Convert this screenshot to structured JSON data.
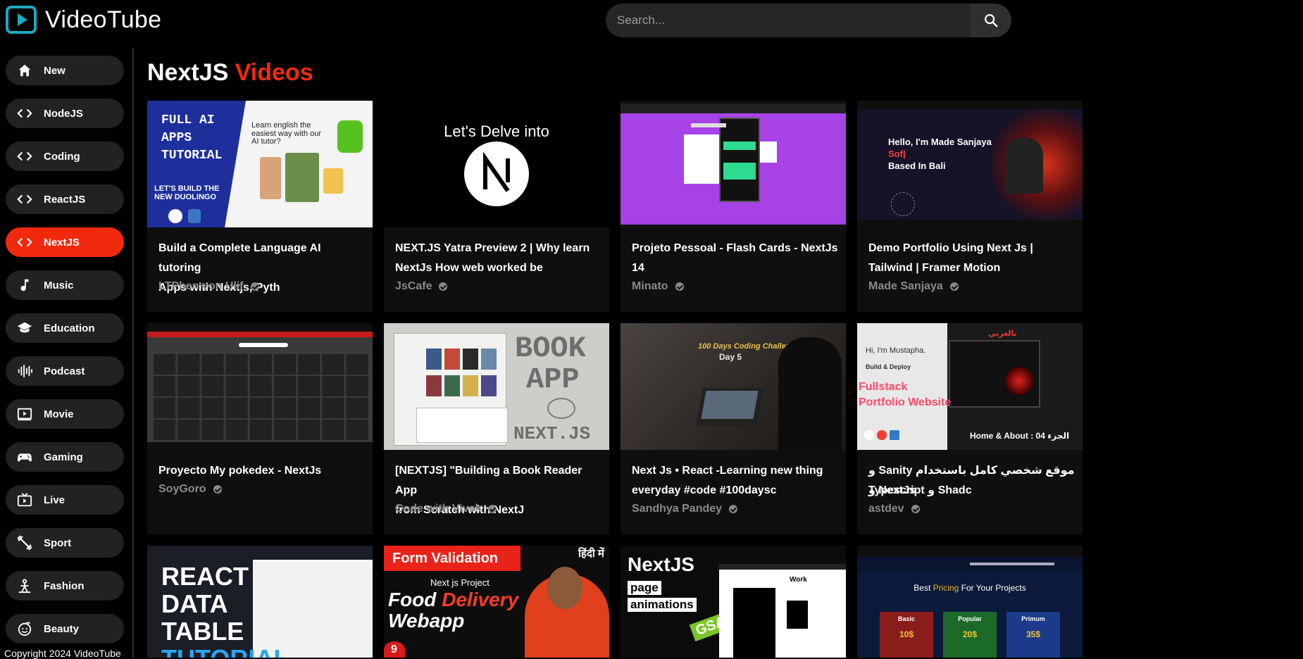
{
  "app": {
    "name": "VideoTube"
  },
  "search": {
    "placeholder": "Search..."
  },
  "sidebar": {
    "items": [
      {
        "label": "New",
        "icon": "home-icon"
      },
      {
        "label": "NodeJS",
        "icon": "code-icon"
      },
      {
        "label": "Coding",
        "icon": "code-icon"
      },
      {
        "label": "ReactJS",
        "icon": "code-icon"
      },
      {
        "label": "NextJS",
        "icon": "code-icon",
        "active": true
      },
      {
        "label": "Music",
        "icon": "music-note-icon"
      },
      {
        "label": "Education",
        "icon": "graduation-cap-icon"
      },
      {
        "label": "Podcast",
        "icon": "podcast-icon"
      },
      {
        "label": "Movie",
        "icon": "movie-icon"
      },
      {
        "label": "Gaming",
        "icon": "gamepad-icon"
      },
      {
        "label": "Live",
        "icon": "live-tv-icon"
      },
      {
        "label": "Sport",
        "icon": "sport-icon"
      },
      {
        "label": "Fashion",
        "icon": "fashion-icon"
      },
      {
        "label": "Beauty",
        "icon": "beauty-icon"
      }
    ],
    "copyright": "Copyright 2024 VideoTube"
  },
  "main": {
    "title_primary": "NextJS",
    "title_accent": "Videos",
    "videos": [
      {
        "title_line1": "Build a Complete Language AI tutoring",
        "title_line2": "Apps with Nextjs, Pyth",
        "channel": "LTPhen von Ulif",
        "thumb_text": [
          "FULL AI",
          "APPS",
          "TUTORIAL"
        ],
        "thumb_text2": "Learn english the easiest way with our AI tutor?",
        "thumb_text3": "LET'S BUILD THE NEW DUOLINGO"
      },
      {
        "title_line1": "NEXT.JS Yatra Preview 2 | Why learn",
        "title_line2": "NextJs How web worked be",
        "channel": "JsCafe",
        "thumb_text": [
          "Let's Delve into"
        ]
      },
      {
        "title_line1": "Projeto Pessoal - Flash Cards - NextJs",
        "title_line2": "14",
        "channel": "Minato"
      },
      {
        "title_line1": "Demo Portfolio Using Next Js |",
        "title_line2": "Tailwind | Framer Motion",
        "channel": "Made Sanjaya",
        "thumb_text": [
          "Hello, I'm Made Sanjaya",
          "Sof|",
          "Based In Bali"
        ]
      },
      {
        "title_line1": "Proyecto My pokedex - NextJs",
        "title_line2": "",
        "channel": "SoyGoro"
      },
      {
        "title_line1": "[NEXTJS] \"Building a Book Reader App",
        "title_line2": "from Scratch with NextJ",
        "channel": "Code with Vivek",
        "thumb_text": [
          "BOOK",
          "APP",
          "NEXT.JS"
        ]
      },
      {
        "title_line1": "Next Js • React -Learning new thing",
        "title_line2": "everyday #code #100daysc",
        "channel": "Sandhya Pandey",
        "thumb_text": [
          "100 Days Coding Challenge",
          "Day 5"
        ]
      },
      {
        "title_line1": "موقع شخصي كامل باستخدام Sanity و NextJs و",
        "title_line2": "Typescript و Shadc",
        "channel": "astdev",
        "thumb_text": [
          "Fullstack",
          "Portfolio Website",
          "Home & About : 04 الجزء",
          "Hi, I'm Mustapha.",
          "Build & Deploy",
          "بالعربي"
        ]
      },
      {
        "thumb_text": [
          "REACT",
          "DATA",
          "TABLE",
          "TUTORIAL"
        ]
      },
      {
        "thumb_text": [
          "Form Validation",
          "Next js Project",
          "Food",
          "Delivery",
          "Webapp",
          "हिंदी में",
          "9"
        ]
      },
      {
        "thumb_text": [
          "NextJS",
          "page",
          "animations",
          "GSAP",
          "Work"
        ]
      },
      {
        "thumb_text": [
          "Best ",
          "Pricing",
          " For Your Projects",
          "Basic",
          "Popular",
          "Primum",
          "10$",
          "20$",
          "35$"
        ]
      }
    ]
  },
  "colors": {
    "accent": "#f22a0d",
    "logo": "#1fa8c0",
    "card": "#0f0f0f",
    "pill": "#222222"
  }
}
